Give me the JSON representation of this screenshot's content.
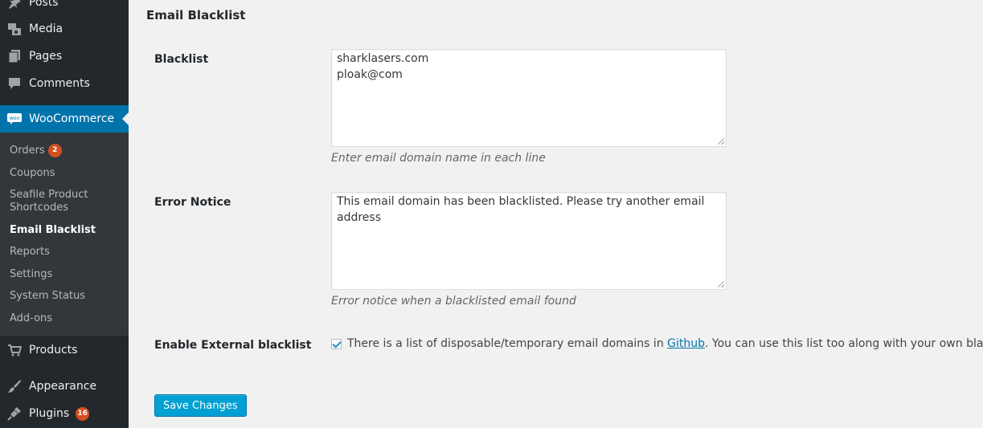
{
  "sidebar": {
    "menu": {
      "posts": "Posts",
      "media": "Media",
      "pages": "Pages",
      "comments": "Comments",
      "woocommerce": "WooCommerce",
      "products": "Products",
      "appearance": "Appearance",
      "plugins": "Plugins"
    },
    "plugins_badge": "16",
    "submenu": {
      "orders": "Orders",
      "orders_badge": "2",
      "coupons": "Coupons",
      "seafile_line1": "Seafile Product",
      "seafile_line2": "Shortcodes",
      "email_blacklist": "Email Blacklist",
      "reports": "Reports",
      "settings": "Settings",
      "system_status": "System Status",
      "add_ons": "Add-ons"
    }
  },
  "main": {
    "title": "Email Blacklist",
    "blacklist": {
      "label": "Blacklist",
      "line1": "sharklasers.com",
      "line2": "ploak@com",
      "description": "Enter email domain name in each line"
    },
    "error_notice": {
      "label": "Error Notice",
      "line1": "This email domain has been blacklisted. Please try another email",
      "line2": "address",
      "description": "Error notice when a blacklisted email found"
    },
    "external": {
      "label": "Enable External blacklist",
      "checked": true,
      "text_before": "There is a list of disposable/temporary email domains in ",
      "link": "Github",
      "text_after": ". You can use this list too along with your own blacklist"
    },
    "save_label": "Save Changes"
  },
  "colors": {
    "sidebar_bg": "#23282d",
    "submenu_bg": "#32373c",
    "active_bg": "#0073aa",
    "badge": "#d54e21",
    "button": "#00a0d2"
  }
}
